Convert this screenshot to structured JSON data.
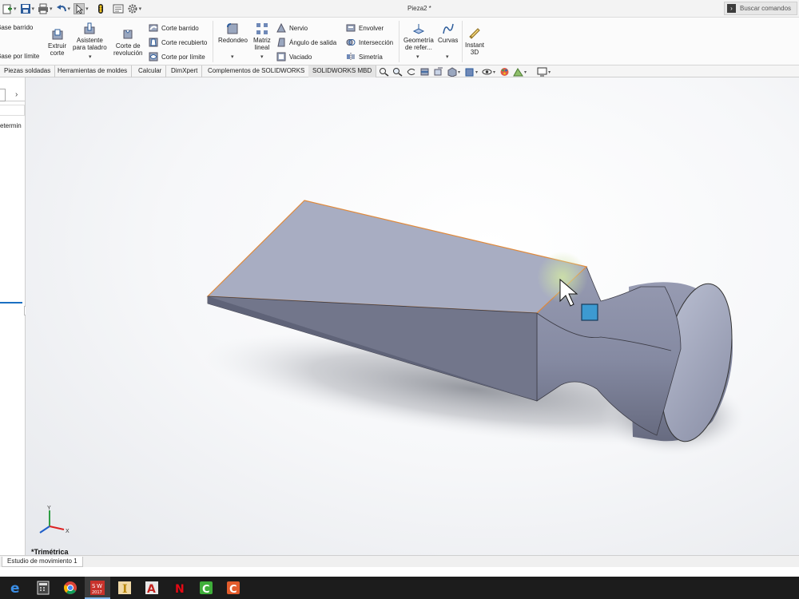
{
  "window": {
    "title": "Pieza2 *",
    "search_placeholder": "Buscar comandos"
  },
  "ribbon": {
    "base_barrido": "Base barrido",
    "base_limite": "Base por límite",
    "extruir_corte": [
      "Extruir",
      "corte"
    ],
    "asistente_taladro": [
      "Asistente",
      "para taladro"
    ],
    "corte_revolucion": [
      "Corte de",
      "revolución"
    ],
    "corte_barrido": "Corte barrido",
    "corte_recubierto": "Corte recubierto",
    "corte_limite": "Corte por límite",
    "redondeo": "Redondeo",
    "matriz_lineal": [
      "Matriz",
      "lineal"
    ],
    "nervio": "Nervio",
    "angulo_salida": "Ángulo de salida",
    "vaciado": "Vaciado",
    "envolver": "Envolver",
    "interseccion": "Intersección",
    "simetria": "Simetría",
    "geometria_ref": [
      "Geometría",
      "de refer..."
    ],
    "curvas": "Curvas",
    "instant3d": [
      "Instant",
      "3D"
    ]
  },
  "tabs": [
    "Piezas soldadas",
    "Herramientas de moldes",
    "Calcular",
    "DimXpert",
    "Complementos de SOLIDWORKS",
    "SOLIDWORKS MBD"
  ],
  "left_panel": {
    "text": "etermin"
  },
  "viewport": {
    "view_name": "*Trimétrica",
    "triad": {
      "x": "X",
      "y": "Y"
    }
  },
  "bottom_tabs": {
    "motion_study": "Estudio de movimiento 1"
  },
  "taskbar": {
    "solidworks_label": "2017",
    "icons": [
      "edge-icon",
      "calculator-icon",
      "chrome-icon",
      "solidworks-icon",
      "inventor-icon",
      "acrobat-icon",
      "netflix-icon",
      "camtasia-icon",
      "camtasia-recorder-icon"
    ]
  },
  "colors": {
    "model_face_top": "#a7acc1",
    "model_face_front": "#777b90",
    "model_highlight_edge": "#e08a3c",
    "selection_square": "#3d9ad1",
    "taskbar": "#1c1c1c"
  }
}
